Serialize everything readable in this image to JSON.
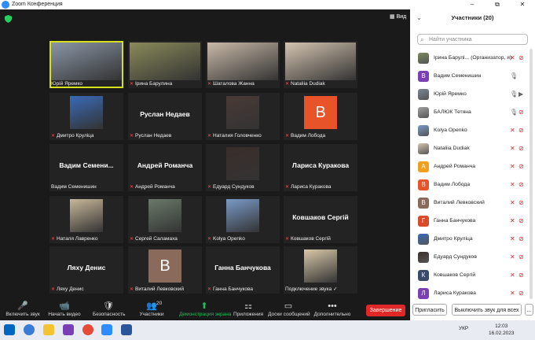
{
  "window": {
    "title": "Zoom Конференция",
    "minimize": "–",
    "maximize": "⧉",
    "close": "✕"
  },
  "view_button": "Вид",
  "tiles": [
    {
      "name": "Юрій Яремко",
      "muted": false,
      "kind": "photo",
      "photo_color": "#8a96a6",
      "active": true
    },
    {
      "name": "Ірина Барулина",
      "muted": true,
      "kind": "photo",
      "photo_color": "#8a8a5a"
    },
    {
      "name": "Шаталова Жанна",
      "muted": true,
      "kind": "photo",
      "photo_color": "#c9b9a8"
    },
    {
      "name": "Nataliia Dudiak",
      "muted": true,
      "kind": "photo",
      "photo_color": "#d4c4b0"
    },
    {
      "name": "Дмитро Круліца",
      "muted": true,
      "kind": "photo",
      "photo_color": "#3a6ab8"
    },
    {
      "name": "Руслан Недаев",
      "muted": true,
      "kind": "text",
      "big": "Руслан Недаев"
    },
    {
      "name": "Наталия Головченко",
      "muted": true,
      "kind": "photo",
      "photo_color": "#4a3a36"
    },
    {
      "name": "Вадим Лобода",
      "muted": true,
      "kind": "avatar",
      "letter": "B",
      "avatar_color": "#e8532a"
    },
    {
      "name": "Вадим Семенишин",
      "muted": false,
      "kind": "text",
      "big": "Вадим  Семени..."
    },
    {
      "name": "Андрей Романча",
      "muted": true,
      "kind": "text",
      "big": "Андрей Романча"
    },
    {
      "name": "Едуард Сундуков",
      "muted": true,
      "kind": "photo",
      "photo_color": "#3a2e2a"
    },
    {
      "name": "Лариса Куракова",
      "muted": true,
      "kind": "text",
      "big": "Лариса Куракова"
    },
    {
      "name": "Наталя Лавренко",
      "muted": true,
      "kind": "photo",
      "photo_color": "#c8b89a"
    },
    {
      "name": "Сергей Саламаха",
      "muted": true,
      "kind": "photo",
      "photo_color": "#6a7a6a"
    },
    {
      "name": "Kolya Openko",
      "muted": true,
      "kind": "photo",
      "photo_color": "#7a9ac8"
    },
    {
      "name": "Ковшаков Сергій",
      "muted": true,
      "kind": "text",
      "big": "Ковшаков Сергій"
    },
    {
      "name": "Ляху Денис",
      "muted": true,
      "kind": "text",
      "big": "Ляху Денис"
    },
    {
      "name": "Виталий Левковский",
      "muted": true,
      "kind": "avatar",
      "letter": "B",
      "avatar_color": "#8a6a5a"
    },
    {
      "name": "Ганна Банчукова",
      "muted": true,
      "kind": "text",
      "big": "Ганна Банчукова"
    },
    {
      "name": "Подключение звука",
      "muted": false,
      "kind": "photo",
      "photo_color": "#d8c8a8",
      "check": "✓"
    }
  ],
  "toolbar": {
    "items": [
      {
        "label": "Включить звук",
        "icon": "🎤"
      },
      {
        "label": "Начать видео",
        "icon": "📹"
      },
      {
        "label": "Безопасность",
        "icon": "🛡"
      },
      {
        "label": "Участники",
        "icon": "👥",
        "count": "20"
      },
      {
        "label": "Демонстрация экрана",
        "icon": "⬆"
      },
      {
        "label": "Приложения",
        "icon": "⚏"
      },
      {
        "label": "Доски сообщений",
        "icon": "▭"
      },
      {
        "label": "Дополнительно",
        "icon": "•••"
      }
    ],
    "end_label": "Завершение",
    "accent": "#1dbf5a"
  },
  "panel": {
    "title": "Участники (20)",
    "search_placeholder": "Найти участника",
    "participants": [
      {
        "name": "Ірина Барулі... (Организатор, я)",
        "avatar": "photo",
        "color": "#7a8a5a",
        "mic": "muted",
        "video": "off"
      },
      {
        "name": "Вадим Семенишин",
        "avatar": "В",
        "color": "#7b3fb5",
        "mic": "on",
        "video": "none"
      },
      {
        "name": "Юрій Яремко",
        "avatar": "photo",
        "color": "#7a8696",
        "mic": "on",
        "video": "on"
      },
      {
        "name": "БАЛЮК Тетяна",
        "avatar": "photo",
        "color": "#a0a0a0",
        "mic": "on",
        "video": "off"
      },
      {
        "name": "Kolya Openko",
        "avatar": "photo",
        "color": "#7a9ac8",
        "mic": "muted",
        "video": "off"
      },
      {
        "name": "Nataliia Dudiak",
        "avatar": "photo",
        "color": "#d4c4b0",
        "mic": "muted",
        "video": "off"
      },
      {
        "name": "Андрей Романча",
        "avatar": "А",
        "color": "#f0a020",
        "mic": "muted",
        "video": "off"
      },
      {
        "name": "Вадим Лобода",
        "avatar": "В",
        "color": "#e8532a",
        "mic": "muted",
        "video": "off"
      },
      {
        "name": "Виталий Левковский",
        "avatar": "В",
        "color": "#8a6a5a",
        "mic": "muted",
        "video": "off"
      },
      {
        "name": "Ганна Банчукова",
        "avatar": "Г",
        "color": "#d84a2a",
        "mic": "muted",
        "video": "off"
      },
      {
        "name": "Дмитро Круліца",
        "avatar": "photo",
        "color": "#3a6ab8",
        "mic": "muted",
        "video": "off"
      },
      {
        "name": "Едуард Сундуков",
        "avatar": "photo",
        "color": "#3a2e2a",
        "mic": "muted",
        "video": "off"
      },
      {
        "name": "Ковшаков Сергій",
        "avatar": "К",
        "color": "#3a4a6a",
        "mic": "muted",
        "video": "off"
      },
      {
        "name": "Лариса Куракова",
        "avatar": "Л",
        "color": "#7b3fb5",
        "mic": "muted",
        "video": "off"
      }
    ],
    "invite_label": "Пригласить",
    "mute_all_label": "Выключить звук для всех"
  },
  "taskbar": {
    "lang": "УКР",
    "time": "12:03",
    "date": "16.02.2023"
  }
}
